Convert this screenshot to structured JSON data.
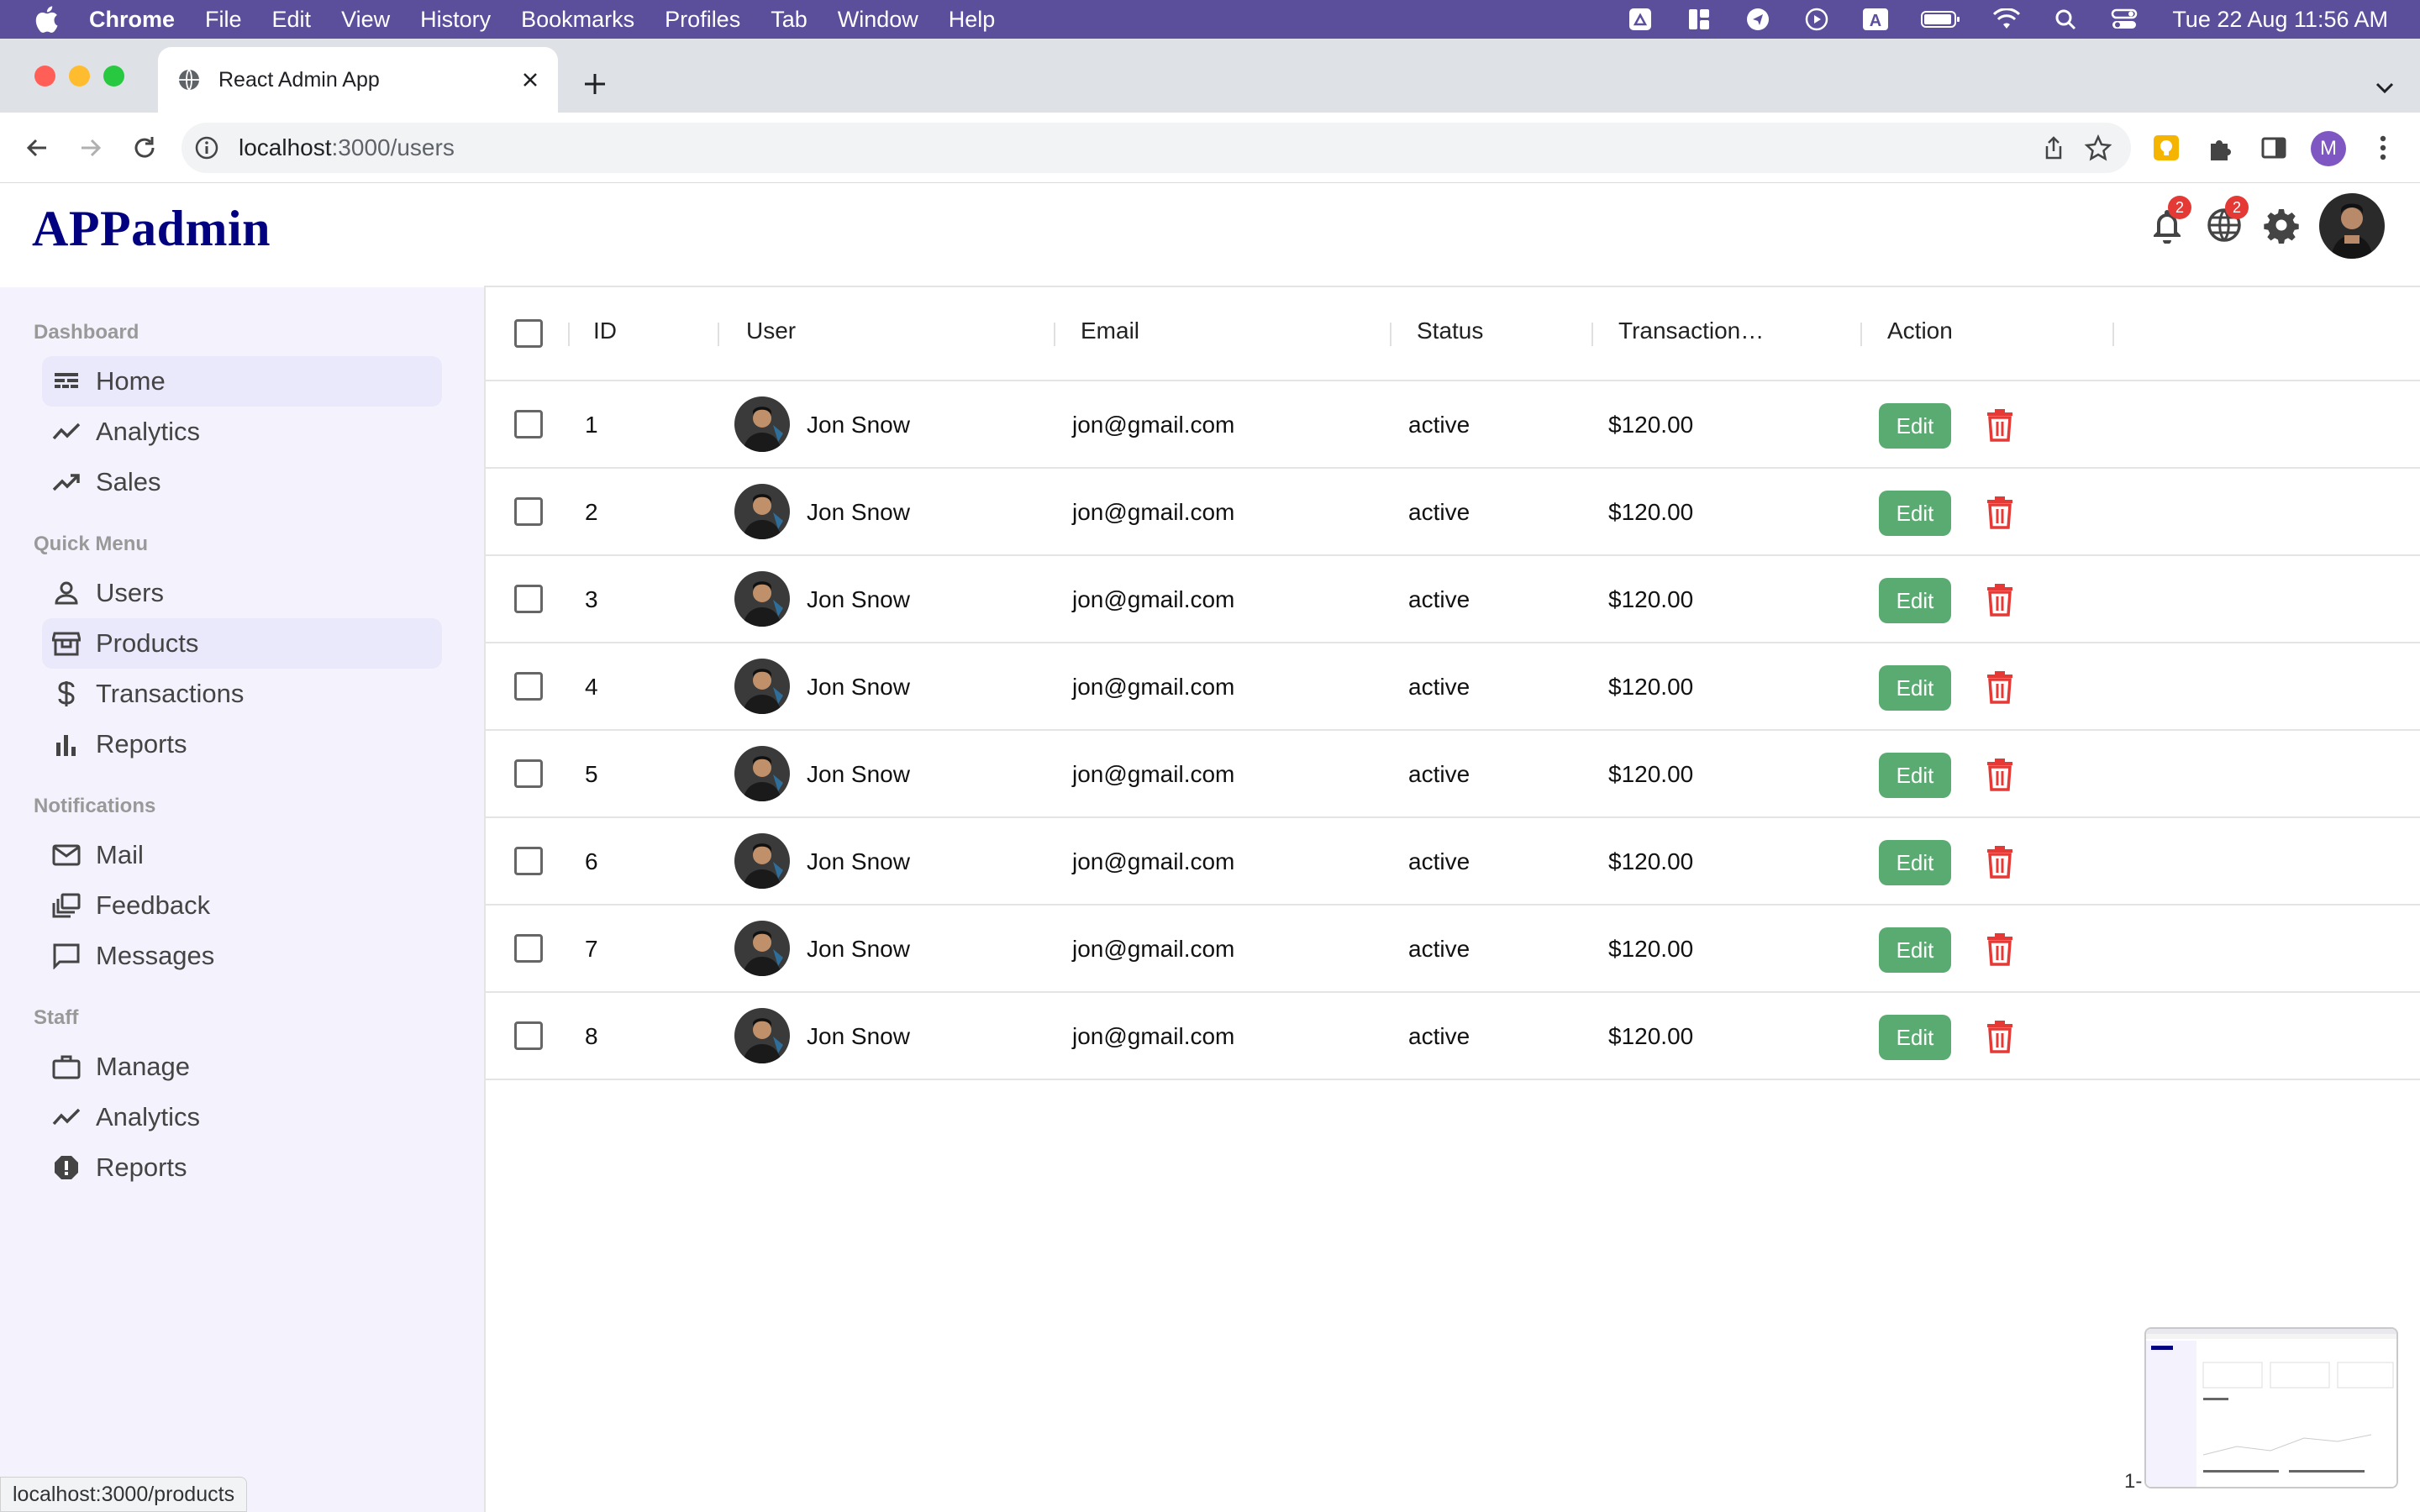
{
  "menubar": {
    "app": "Chrome",
    "items": [
      "File",
      "Edit",
      "View",
      "History",
      "Bookmarks",
      "Profiles",
      "Tab",
      "Window",
      "Help"
    ],
    "clock": "Tue 22 Aug  11:56 AM",
    "status_icons": [
      "drive-icon",
      "grid-icon",
      "send-icon",
      "play-icon",
      "keyboard-a-icon",
      "battery-icon",
      "wifi-icon",
      "spotlight-icon",
      "control-center-icon"
    ]
  },
  "browser": {
    "tab_title": "React Admin App",
    "url_host": "localhost",
    "url_path": ":3000/users",
    "profile_initial": "M",
    "status_url": "localhost:3000/products"
  },
  "app": {
    "logo": "APPadmin",
    "notifications_count": "2",
    "language_count": "2"
  },
  "sidebar": {
    "sections": [
      {
        "title": "Dashboard",
        "items": [
          {
            "label": "Home",
            "icon": "dashboard-icon",
            "active": true
          },
          {
            "label": "Analytics",
            "icon": "line-chart-icon"
          },
          {
            "label": "Sales",
            "icon": "trending-up-icon"
          }
        ]
      },
      {
        "title": "Quick Menu",
        "items": [
          {
            "label": "Users",
            "icon": "person-icon"
          },
          {
            "label": "Products",
            "icon": "storefront-icon",
            "active": true
          },
          {
            "label": "Transactions",
            "icon": "dollar-icon"
          },
          {
            "label": "Reports",
            "icon": "bar-chart-icon"
          }
        ]
      },
      {
        "title": "Notifications",
        "items": [
          {
            "label": "Mail",
            "icon": "mail-icon"
          },
          {
            "label": "Feedback",
            "icon": "dynamic-feed-icon"
          },
          {
            "label": "Messages",
            "icon": "chat-bubble-icon"
          }
        ]
      },
      {
        "title": "Staff",
        "items": [
          {
            "label": "Manage",
            "icon": "briefcase-icon"
          },
          {
            "label": "Analytics",
            "icon": "line-chart-icon"
          },
          {
            "label": "Reports",
            "icon": "report-icon"
          }
        ]
      }
    ]
  },
  "table": {
    "columns": [
      "ID",
      "User",
      "Email",
      "Status",
      "Transaction…",
      "Action"
    ],
    "edit_label": "Edit",
    "rows": [
      {
        "id": "1",
        "user": "Jon Snow",
        "email": "jon@gmail.com",
        "status": "active",
        "transaction": "$120.00"
      },
      {
        "id": "2",
        "user": "Jon Snow",
        "email": "jon@gmail.com",
        "status": "active",
        "transaction": "$120.00"
      },
      {
        "id": "3",
        "user": "Jon Snow",
        "email": "jon@gmail.com",
        "status": "active",
        "transaction": "$120.00"
      },
      {
        "id": "4",
        "user": "Jon Snow",
        "email": "jon@gmail.com",
        "status": "active",
        "transaction": "$120.00"
      },
      {
        "id": "5",
        "user": "Jon Snow",
        "email": "jon@gmail.com",
        "status": "active",
        "transaction": "$120.00"
      },
      {
        "id": "6",
        "user": "Jon Snow",
        "email": "jon@gmail.com",
        "status": "active",
        "transaction": "$120.00"
      },
      {
        "id": "7",
        "user": "Jon Snow",
        "email": "jon@gmail.com",
        "status": "active",
        "transaction": "$120.00"
      },
      {
        "id": "8",
        "user": "Jon Snow",
        "email": "jon@gmail.com",
        "status": "active",
        "transaction": "$120.00"
      }
    ],
    "pager_fragment": "1-"
  },
  "colors": {
    "logo": "#020180",
    "edit_button": "#5aab72",
    "delete_icon": "#e53935",
    "sidebar_bg": "#f4f3fd",
    "active_item": "#eae8fb",
    "menubar": "#5b4f9c"
  }
}
